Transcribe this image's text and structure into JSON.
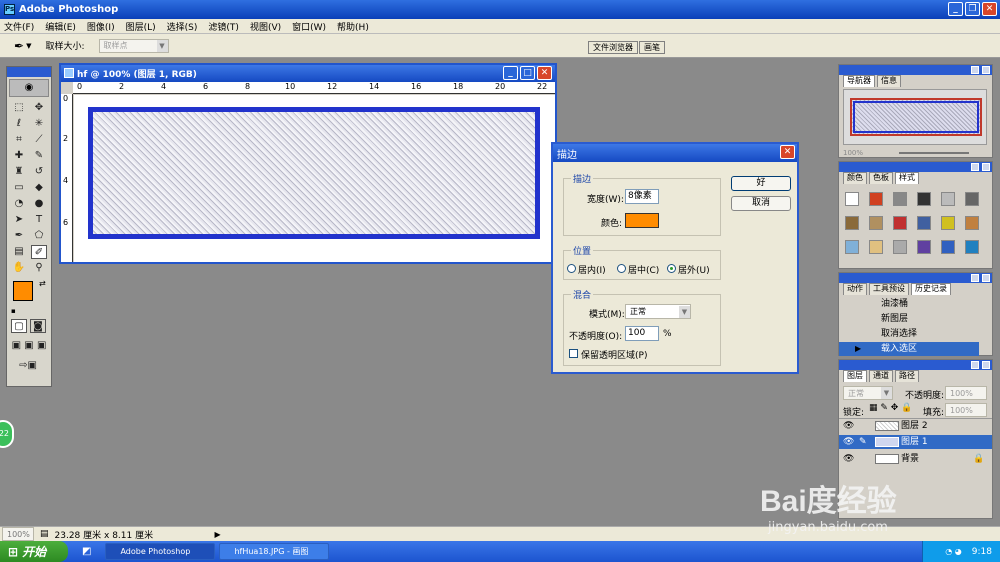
{
  "app": {
    "title": "Adobe Photoshop"
  },
  "menu": [
    "文件(F)",
    "编辑(E)",
    "图像(I)",
    "图层(L)",
    "选择(S)",
    "滤镜(T)",
    "视图(V)",
    "窗口(W)",
    "帮助(H)"
  ],
  "options": {
    "sample_label": "取样大小:",
    "sample_value": "取样点",
    "palette_tabs": [
      "文件浏览器",
      "画笔"
    ]
  },
  "document": {
    "title": "hf @ 100% (图层 1, RGB)",
    "ruler_top": [
      "0",
      "2",
      "4",
      "6",
      "8",
      "10",
      "12",
      "14",
      "16",
      "18",
      "20",
      "22"
    ],
    "ruler_left": [
      "0",
      "2",
      "4",
      "6"
    ]
  },
  "dialog": {
    "title": "描边",
    "stroke_group": "描边",
    "width_label": "宽度(W):",
    "width_value": "8像素",
    "color_label": "颜色:",
    "stroke_color": "#ff8c00",
    "ok": "好",
    "cancel": "取消",
    "location_group": "位置",
    "location_options": [
      "居内(I)",
      "居中(C)",
      "居外(U)"
    ],
    "location_selected": "居外(U)",
    "blend_group": "混合",
    "mode_label": "模式(M):",
    "mode_value": "正常",
    "opacity_label": "不透明度(O):",
    "opacity_value": "100",
    "opacity_unit": "%",
    "preserve_label": "保留透明区域(P)"
  },
  "navigator": {
    "tabs": [
      "导航器",
      "信息"
    ],
    "zoom": "100%"
  },
  "swatches": {
    "tabs": [
      "颜色",
      "色板",
      "样式"
    ]
  },
  "history": {
    "tabs": [
      "动作",
      "工具预设",
      "历史记录"
    ],
    "items": [
      "油漆桶",
      "新图层",
      "取消选择",
      "载入选区"
    ]
  },
  "layers": {
    "tabs": [
      "图层",
      "通道",
      "路径"
    ],
    "blend_mode": "正常",
    "opacity_label": "不透明度:",
    "opacity_value": "100%",
    "lock_label": "锁定:",
    "fill_label": "填充:",
    "fill_value": "100%",
    "items": [
      "图层 2",
      "图层 1",
      "背景"
    ]
  },
  "status": {
    "zoom": "100%",
    "doc_size": "23.28 厘米 x 8.11 厘米"
  },
  "taskbar": {
    "start": "开始",
    "tasks": [
      "Adobe Photoshop",
      "hfHua18.JPG - 画图"
    ],
    "clock": "9:18"
  },
  "badge": "22",
  "watermark": {
    "brand": "Bai度经验",
    "url": "jingyan.baidu.com"
  },
  "colors": {
    "foreground": "#ff8c00",
    "background": "#000000",
    "selection": "#2233cc",
    "highlight": "#316ac5"
  }
}
